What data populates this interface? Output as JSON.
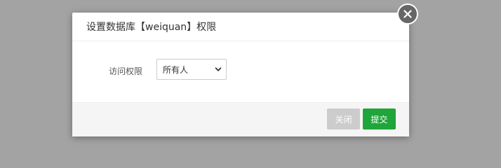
{
  "dialog": {
    "title": "设置数据库【weiquan】权限",
    "field_label": "访问权限",
    "access_select": {
      "selected": "所有人"
    },
    "buttons": {
      "close": "关闭",
      "submit": "提交"
    }
  },
  "colors": {
    "overlay": "#a3a3a3",
    "submit": "#20a53a",
    "close_button": "#cccccc",
    "footer": "#f4f5f4"
  },
  "icons": {
    "dialog_close": "close-icon",
    "select_chevron": "chevron-down-icon"
  }
}
